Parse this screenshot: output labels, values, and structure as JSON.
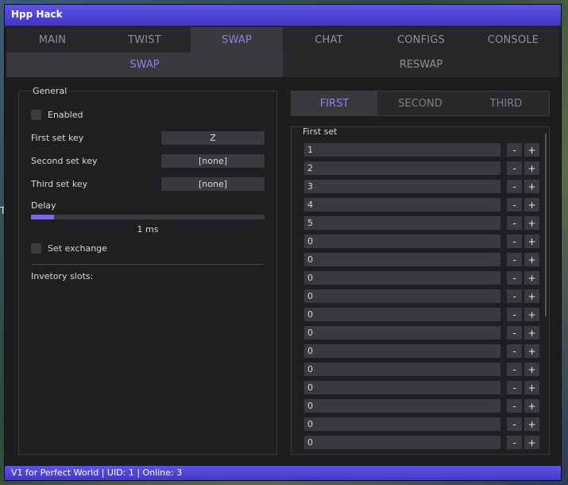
{
  "window": {
    "title": "Hpp Hack"
  },
  "main_tabs": [
    {
      "label": "MAIN"
    },
    {
      "label": "TWIST"
    },
    {
      "label": "SWAP"
    },
    {
      "label": "CHAT"
    },
    {
      "label": "CONFIGS"
    },
    {
      "label": "CONSOLE"
    }
  ],
  "active_main_tab": "SWAP",
  "sub_tabs": [
    {
      "label": "SWAP"
    },
    {
      "label": "RESWAP"
    }
  ],
  "general": {
    "title": "General",
    "enabled_label": "Enabled",
    "first_set_key_label": "First set key",
    "first_set_key_value": "Z",
    "second_set_key_label": "Second set key",
    "second_set_key_value": "[none]",
    "third_set_key_label": "Third set key",
    "third_set_key_value": "[none]",
    "delay_label": "Delay",
    "delay_value": "1 ms",
    "delay_fill_fraction": 0.1,
    "set_exchange_label": "Set exchange",
    "inventory_label": "Invetory slots:"
  },
  "set_tabs": [
    {
      "label": "FIRST"
    },
    {
      "label": "SECOND"
    },
    {
      "label": "THIRD"
    }
  ],
  "first_set": {
    "title": "First set",
    "minus_label": "-",
    "plus_label": "+",
    "slots": [
      "1",
      "2",
      "3",
      "4",
      "5",
      "0",
      "0",
      "0",
      "0",
      "0",
      "0",
      "0",
      "0",
      "0",
      "0",
      "0",
      "0"
    ]
  },
  "status": {
    "text": "V1 for Perfect World | UID: 1 | Online: 3"
  },
  "edge_text": "T",
  "colors": {
    "accent": "#5e54e6",
    "active_text": "#8f7df2",
    "panel": "#1d1d1f"
  }
}
